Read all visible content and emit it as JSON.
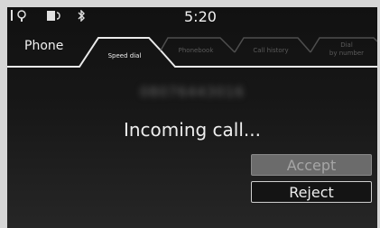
{
  "status": {
    "time": "5:20",
    "icons": [
      "antenna-icon",
      "headset-icon",
      "phone-battery-icon",
      "bluetooth-icon"
    ]
  },
  "header": {
    "title": "Phone"
  },
  "tabs": [
    {
      "label": "Speed dial",
      "active": true
    },
    {
      "label": "Phonebook",
      "active": false
    },
    {
      "label": "Call history",
      "active": false
    },
    {
      "label": "Dial",
      "label2": "by number",
      "active": false
    }
  ],
  "call": {
    "number": "08076443016",
    "status_text": "Incoming call...",
    "accept_label": "Accept",
    "reject_label": "Reject"
  },
  "colors": {
    "background": "#151515",
    "accent_text": "#f0f0f0",
    "inactive_tab": "#5a5a5a",
    "accept_fill": "#6b6b6b"
  }
}
